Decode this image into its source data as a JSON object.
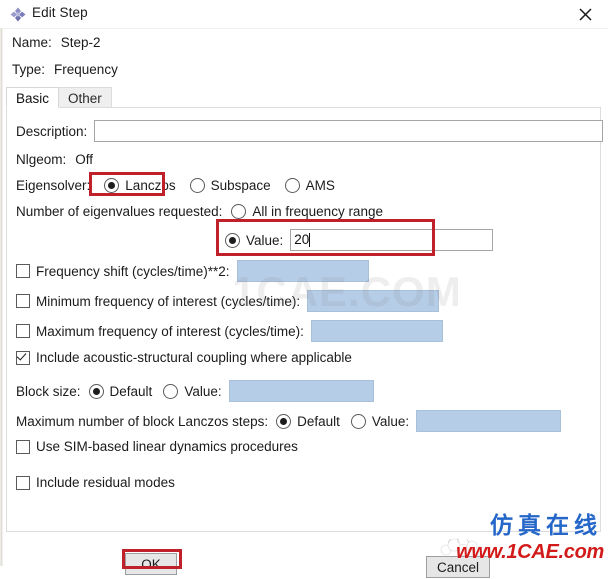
{
  "window": {
    "title": "Edit Step",
    "icon": "abaqus-diamond-icon",
    "close_label": "✕"
  },
  "header": {
    "name_label": "Name:",
    "name_value": "Step-2",
    "type_label": "Type:",
    "type_value": "Frequency"
  },
  "tabs": [
    {
      "label": "Basic",
      "active": true
    },
    {
      "label": "Other",
      "active": false
    }
  ],
  "form": {
    "description_label": "Description:",
    "description_value": "",
    "description_placeholder": "",
    "nlgeom_label": "Nlgeom:",
    "nlgeom_value": "Off",
    "eigensolver_label": "Eigensolver:",
    "eigensolver_options": [
      {
        "label": "Lanczos",
        "selected": true
      },
      {
        "label": "Subspace",
        "selected": false
      },
      {
        "label": "AMS",
        "selected": false
      }
    ],
    "num_eigen_label": "Number of eigenvalues requested:",
    "num_eigen_all_label": "All in frequency range",
    "num_eigen_all_selected": false,
    "num_eigen_value_label": "Value:",
    "num_eigen_value_selected": true,
    "num_eigen_value": "20",
    "freq_shift_label": "Frequency shift (cycles/time)**2:",
    "freq_shift_checked": false,
    "freq_shift_value": "",
    "min_freq_label": "Minimum frequency of interest (cycles/time):",
    "min_freq_checked": false,
    "min_freq_value": "",
    "max_freq_label": "Maximum frequency of interest (cycles/time):",
    "max_freq_checked": false,
    "max_freq_value": "",
    "acoustic_label": "Include acoustic-structural coupling where applicable",
    "acoustic_checked": true,
    "block_size_label": "Block size:",
    "block_size_default_label": "Default",
    "block_size_default_selected": true,
    "block_size_value_label": "Value:",
    "block_size_value_selected": false,
    "block_size_value": "",
    "max_steps_label": "Maximum number of block Lanczos steps:",
    "max_steps_default_label": "Default",
    "max_steps_default_selected": true,
    "max_steps_value_label": "Value:",
    "max_steps_value_selected": false,
    "max_steps_value": "",
    "sim_label": "Use SIM-based linear dynamics procedures",
    "sim_checked": false,
    "residual_label": "Include residual modes",
    "residual_checked": false
  },
  "buttons": {
    "ok_label": "OK",
    "cancel_label": "Cancel"
  },
  "annotations": {
    "highlight_color": "#c0202a",
    "boxes": [
      "eigensolver-lanczos",
      "num-eigenvalues-value",
      "ok-button"
    ]
  },
  "watermarks": {
    "center": "1CAE.COM",
    "chinese": "仿真在线",
    "url": "www.1CAE.com"
  },
  "colors": {
    "disabled_field": "#b6cde7",
    "accent_red": "#c0202a",
    "watermark_blue": "#2566c9",
    "watermark_red": "#d21a1a"
  }
}
